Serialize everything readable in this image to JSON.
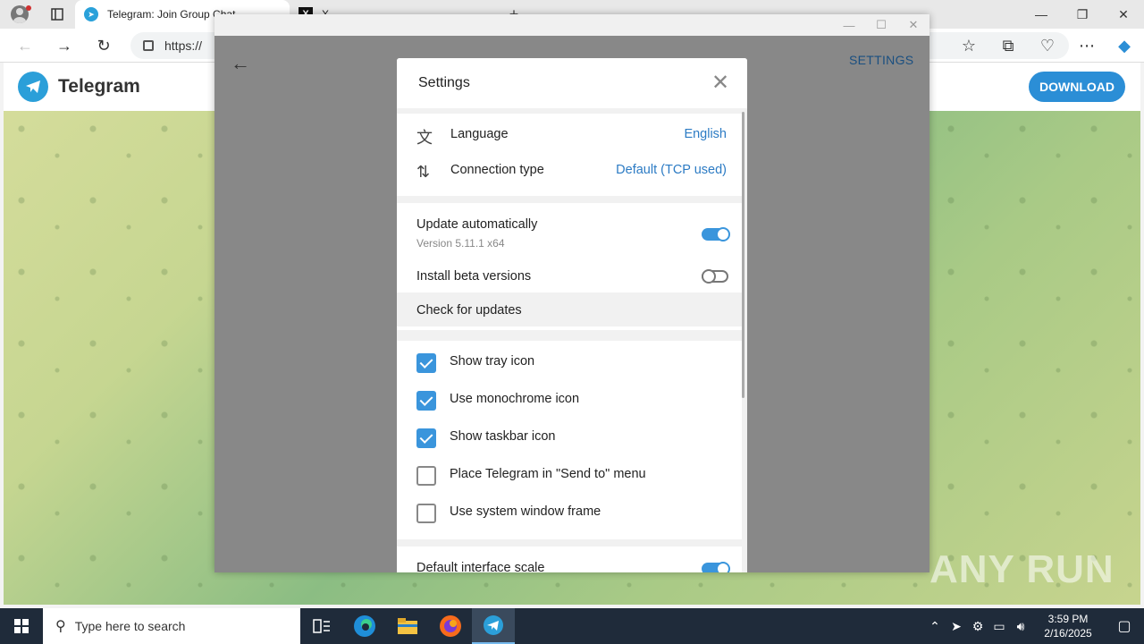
{
  "browser": {
    "tabs": [
      {
        "title": "Telegram: Join Group Chat",
        "active": true
      },
      {
        "title": "X",
        "active": false
      }
    ],
    "url": "https://"
  },
  "page": {
    "brand": "Telegram",
    "download_label": "DOWNLOAD"
  },
  "telegram_window": {
    "settings_link": "SETTINGS"
  },
  "settings_dialog": {
    "title": "Settings",
    "language_label": "Language",
    "language_value": "English",
    "connection_label": "Connection type",
    "connection_value": "Default (TCP used)",
    "update_auto_label": "Update automatically",
    "update_auto_on": true,
    "version_text": "Version 5.11.1 x64",
    "beta_label": "Install beta versions",
    "beta_on": false,
    "check_updates_label": "Check for updates",
    "checkboxes": [
      {
        "label": "Show tray icon",
        "checked": true
      },
      {
        "label": "Use monochrome icon",
        "checked": true
      },
      {
        "label": "Show taskbar icon",
        "checked": true
      },
      {
        "label": "Place Telegram in \"Send to\" menu",
        "checked": false
      },
      {
        "label": "Use system window frame",
        "checked": false
      }
    ],
    "scale_label": "Default interface scale",
    "scale_on": true
  },
  "watermark": "ANY RUN",
  "taskbar": {
    "search_placeholder": "Type here to search",
    "time": "3:59 PM",
    "date": "2/16/2025"
  },
  "colors": {
    "accent": "#3a95dc",
    "link": "#2c7bc4",
    "taskbar": "#1f2b3a"
  }
}
